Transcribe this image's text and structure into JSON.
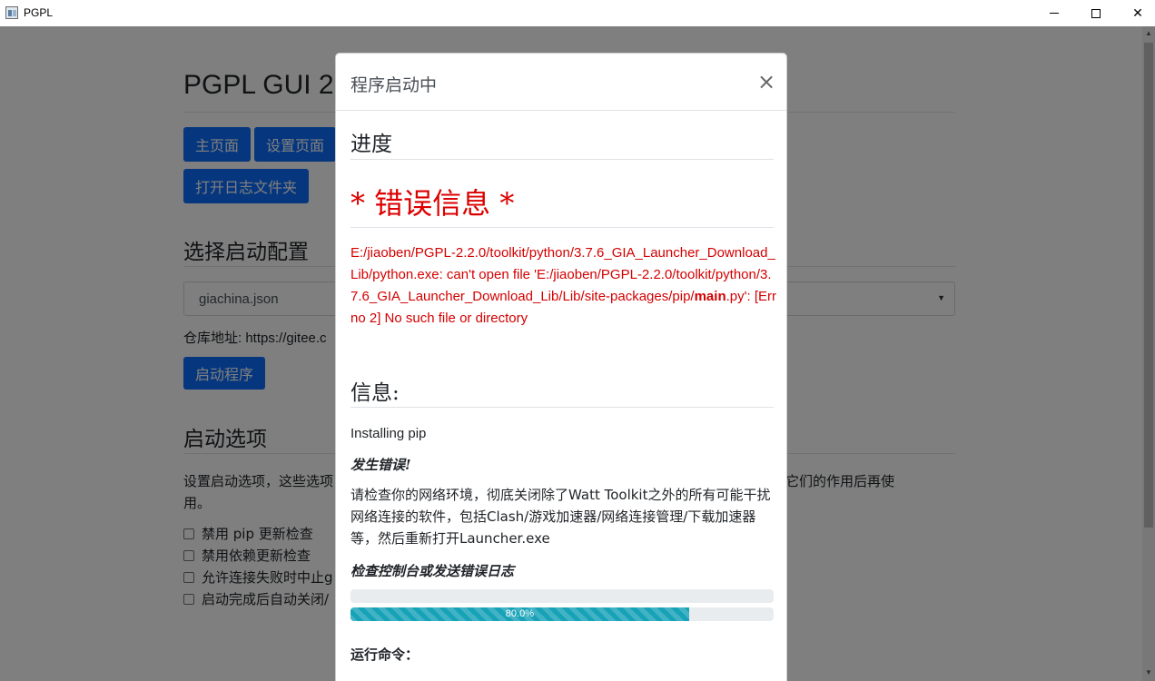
{
  "window": {
    "title": "PGPL",
    "minimize_icon": "minimize-icon",
    "maximize_icon": "maximize-icon",
    "close_icon": "close-icon"
  },
  "page": {
    "title": "PGPL GUI 2.",
    "nav": {
      "home_label": "主页面",
      "settings_label": "设置页面",
      "open_log_label": "打开日志文件夹"
    },
    "config_section": {
      "title": "选择启动配置",
      "selected": "giachina.json",
      "repo_label": "仓库地址: https://gitee.c",
      "start_label": "启动程序"
    },
    "options_section": {
      "title": "启动选项",
      "description_left": "设置启动选项，这些选项",
      "description_right": "已了解它们的作用后再使",
      "description_tail": "用。",
      "options": [
        "禁用 pip 更新检查",
        "禁用依赖更新检查",
        "允许连接失败时中止g",
        "启动完成后自动关闭/"
      ]
    }
  },
  "modal": {
    "title": "程序启动中",
    "close_symbol": "×",
    "progress_heading": "进度",
    "error_heading": "* 错误信息 *",
    "error_text_before": "E:/jiaoben/PGPL-2.2.0/toolkit/python/3.7.6_GIA_Launcher_Download_Lib/python.exe: can't open file 'E:/jiaoben/PGPL-2.2.0/toolkit/python/3.7.6_GIA_Launcher_Download_Lib/Lib/site-packages/pip/",
    "error_text_bold": "main",
    "error_text_after": ".py': [Errno 2] No such file or directory",
    "info_heading": "信息:",
    "info_installing": "Installing pip",
    "error_occurred": "发生错误!",
    "advice": "请检查你的网络环境，彻底关闭除了Watt Toolkit之外的所有可能干扰网络连接的软件，包括Clash/游戏加速器/网络连接管理/下载加速器等，然后重新打开Launcher.exe",
    "check_console": "检查控制台或发送错误日志",
    "progress_empty": 0,
    "progress_value": 80,
    "progress_label": "80.0%",
    "run_command_label": "运行命令："
  }
}
